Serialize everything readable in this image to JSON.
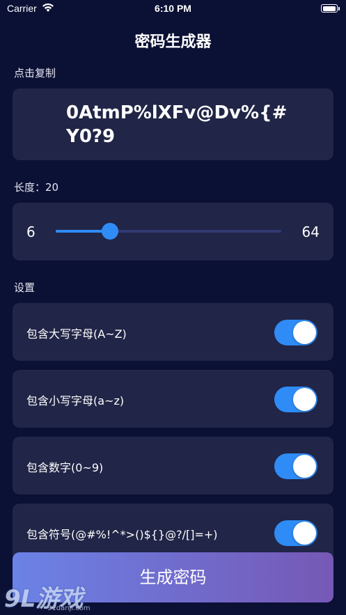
{
  "status_bar": {
    "carrier": "Carrier",
    "time": "6:10 PM"
  },
  "app": {
    "title": "密码生成器"
  },
  "password": {
    "section_label": "点击复制",
    "value": "0AtmP%lXFv@Dv%{#Y0?9"
  },
  "length": {
    "label": "长度：20",
    "value": 20,
    "min": 6,
    "max": 64,
    "min_label": "6",
    "max_label": "64"
  },
  "settings": {
    "section_label": "设置",
    "options": [
      {
        "label": "包含大写字母(A~Z)",
        "enabled": true
      },
      {
        "label": "包含小写字母(a~z)",
        "enabled": true
      },
      {
        "label": "包含数字(0~9)",
        "enabled": true
      },
      {
        "label": "包含符号(@#%!^*>()${}@?/[]=+)",
        "enabled": true
      }
    ]
  },
  "generate_button": {
    "label": "生成密码"
  },
  "watermark": {
    "logo_text": "9L游戏",
    "url": "91danji.com"
  },
  "colors": {
    "background": "#0b1035",
    "card": "#212547",
    "accent": "#2f8cf6",
    "button_gradient_start": "#6b82e6",
    "button_gradient_end": "#7658b5"
  }
}
